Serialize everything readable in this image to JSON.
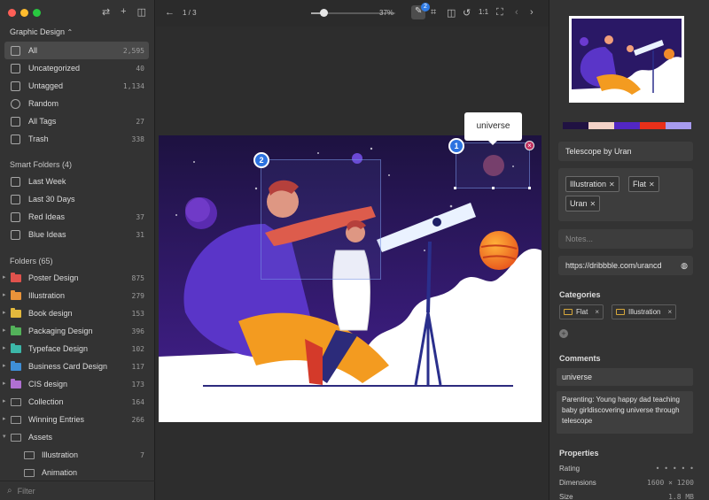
{
  "sidebar": {
    "library_title": "Graphic Design",
    "library_chevron": "⌃",
    "main_items": [
      {
        "label": "All",
        "count": "2,595",
        "icon": "all-icon"
      },
      {
        "label": "Uncategorized",
        "count": "40",
        "icon": "uncategorized-icon"
      },
      {
        "label": "Untagged",
        "count": "1,134",
        "icon": "untagged-icon"
      },
      {
        "label": "Random",
        "count": "",
        "icon": "random-icon"
      },
      {
        "label": "All Tags",
        "count": "27",
        "icon": "tags-icon"
      },
      {
        "label": "Trash",
        "count": "338",
        "icon": "trash-icon"
      }
    ],
    "smart_folders_label": "Smart Folders (4)",
    "smart_folders": [
      {
        "label": "Last Week",
        "count": ""
      },
      {
        "label": "Last 30 Days",
        "count": ""
      },
      {
        "label": "Red Ideas",
        "count": "37"
      },
      {
        "label": "Blue Ideas",
        "count": "31"
      }
    ],
    "folders_label": "Folders (65)",
    "folders": [
      {
        "label": "Poster Design",
        "count": "875",
        "color": "#e0524c"
      },
      {
        "label": "Illustration",
        "count": "279",
        "color": "#e9933a"
      },
      {
        "label": "Book design",
        "count": "153",
        "color": "#e3b93d"
      },
      {
        "label": "Packaging Design",
        "count": "396",
        "color": "#53b25a"
      },
      {
        "label": "Typeface Design",
        "count": "102",
        "color": "#3cb7a8"
      },
      {
        "label": "Business Card Design",
        "count": "117",
        "color": "#3f8fd6"
      },
      {
        "label": "CIS design",
        "count": "173",
        "color": "#b070d2"
      },
      {
        "label": "Collection",
        "count": "164",
        "color": "#999999"
      },
      {
        "label": "Winning Entries",
        "count": "266",
        "color": "#999999"
      },
      {
        "label": "Assets",
        "count": "",
        "color": "#999999"
      }
    ],
    "sub_folders": [
      {
        "label": "Illustration",
        "count": "7"
      },
      {
        "label": "Animation",
        "count": ""
      }
    ],
    "filter_placeholder": "Filter"
  },
  "toolbar": {
    "back_icon": "←",
    "page_indicator": "1 / 3",
    "zoom_level": "37%",
    "zoom_fraction": 0.15,
    "annotation_count": "2",
    "prev_icon": "‹",
    "next_icon": "›",
    "one_to_one": "1:1"
  },
  "canvas": {
    "tooltip_text": "universe",
    "annotations": [
      {
        "number": "1"
      },
      {
        "number": "2"
      }
    ],
    "delete_icon": "×"
  },
  "inspector": {
    "palette": [
      "#201242",
      "#f3d2c7",
      "#5227c4",
      "#e8301a",
      "#a79bef"
    ],
    "title_value": "Telescope  by Uran",
    "tags": [
      {
        "label": "Illustration"
      },
      {
        "label": "Flat"
      },
      {
        "label": "Uran"
      }
    ],
    "notes_placeholder": "Notes...",
    "url_value": "https://dribbble.com/urancd",
    "categories_label": "Categories",
    "categories": [
      {
        "label": "Flat"
      },
      {
        "label": "Illustration"
      }
    ],
    "comments_label": "Comments",
    "comment_title": "universe",
    "comment_body": "Parenting: Young happy dad teaching baby girldiscovering universe through telescope",
    "properties_label": "Properties",
    "properties": [
      {
        "label": "Rating",
        "value": "• • • • •"
      },
      {
        "label": "Dimensions",
        "value": "1600 × 1200"
      },
      {
        "label": "Size",
        "value": "1.8 MB"
      }
    ]
  }
}
